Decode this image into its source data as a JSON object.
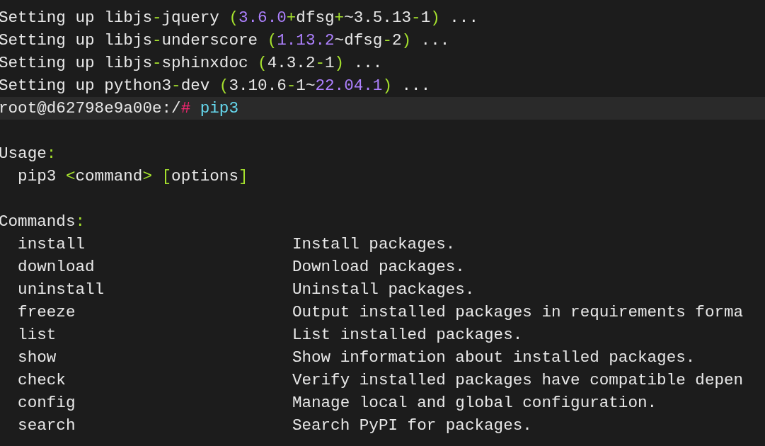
{
  "log_lines": [
    {
      "segments": [
        {
          "text": "Setting up libjs",
          "kind": "plain"
        },
        {
          "text": "-",
          "kind": "punct"
        },
        {
          "text": "jquery ",
          "kind": "plain"
        },
        {
          "text": "(",
          "kind": "punct"
        },
        {
          "text": "3.6.0",
          "kind": "number"
        },
        {
          "text": "+",
          "kind": "punct"
        },
        {
          "text": "dfsg",
          "kind": "plain"
        },
        {
          "text": "+",
          "kind": "punct"
        },
        {
          "text": "~3.5.13",
          "kind": "plain"
        },
        {
          "text": "-",
          "kind": "punct"
        },
        {
          "text": "1",
          "kind": "plain"
        },
        {
          "text": ")",
          "kind": "punct"
        },
        {
          "text": " ...",
          "kind": "plain"
        }
      ]
    },
    {
      "segments": [
        {
          "text": "Setting up libjs",
          "kind": "plain"
        },
        {
          "text": "-",
          "kind": "punct"
        },
        {
          "text": "underscore ",
          "kind": "plain"
        },
        {
          "text": "(",
          "kind": "punct"
        },
        {
          "text": "1.13.2",
          "kind": "number"
        },
        {
          "text": "~dfsg",
          "kind": "plain"
        },
        {
          "text": "-",
          "kind": "punct"
        },
        {
          "text": "2",
          "kind": "plain"
        },
        {
          "text": ")",
          "kind": "punct"
        },
        {
          "text": " ...",
          "kind": "plain"
        }
      ]
    },
    {
      "segments": [
        {
          "text": "Setting up libjs",
          "kind": "plain"
        },
        {
          "text": "-",
          "kind": "punct"
        },
        {
          "text": "sphinxdoc ",
          "kind": "plain"
        },
        {
          "text": "(",
          "kind": "punct"
        },
        {
          "text": "4.3.2",
          "kind": "plain"
        },
        {
          "text": "-",
          "kind": "punct"
        },
        {
          "text": "1",
          "kind": "plain"
        },
        {
          "text": ")",
          "kind": "punct"
        },
        {
          "text": " ...",
          "kind": "plain"
        }
      ]
    },
    {
      "segments": [
        {
          "text": "Setting up python3",
          "kind": "plain"
        },
        {
          "text": "-",
          "kind": "punct"
        },
        {
          "text": "dev ",
          "kind": "plain"
        },
        {
          "text": "(",
          "kind": "punct"
        },
        {
          "text": "3.10.6",
          "kind": "plain"
        },
        {
          "text": "-",
          "kind": "punct"
        },
        {
          "text": "1~",
          "kind": "plain"
        },
        {
          "text": "22.04.1",
          "kind": "number"
        },
        {
          "text": ")",
          "kind": "punct"
        },
        {
          "text": " ...",
          "kind": "plain"
        }
      ]
    }
  ],
  "prompt": {
    "user_host": "root@d62798e9a00e:/",
    "symbol": "#",
    "command": "pip3"
  },
  "usage": {
    "heading": [
      {
        "text": "Usage",
        "kind": "plain"
      },
      {
        "text": ":",
        "kind": "punct"
      }
    ],
    "syntax": [
      {
        "text": "pip3 ",
        "kind": "plain"
      },
      {
        "text": "<",
        "kind": "punct"
      },
      {
        "text": "command",
        "kind": "plain"
      },
      {
        "text": ">",
        "kind": "punct"
      },
      {
        "text": " [",
        "kind": "punct"
      },
      {
        "text": "options",
        "kind": "plain"
      },
      {
        "text": "]",
        "kind": "punct"
      }
    ]
  },
  "commands": {
    "heading": [
      {
        "text": "Commands",
        "kind": "plain"
      },
      {
        "text": ":",
        "kind": "punct"
      }
    ],
    "rows": [
      {
        "name": "install",
        "description": "Install packages."
      },
      {
        "name": "download",
        "description": "Download packages."
      },
      {
        "name": "uninstall",
        "description": "Uninstall packages."
      },
      {
        "name": "freeze",
        "description": "Output installed packages in requirements forma"
      },
      {
        "name": "list",
        "description": "List installed packages."
      },
      {
        "name": "show",
        "description": "Show information about installed packages."
      },
      {
        "name": "check",
        "description": "Verify installed packages have compatible depen"
      },
      {
        "name": "config",
        "description": "Manage local and global configuration."
      },
      {
        "name": "search",
        "description": "Search PyPI for packages."
      }
    ]
  }
}
